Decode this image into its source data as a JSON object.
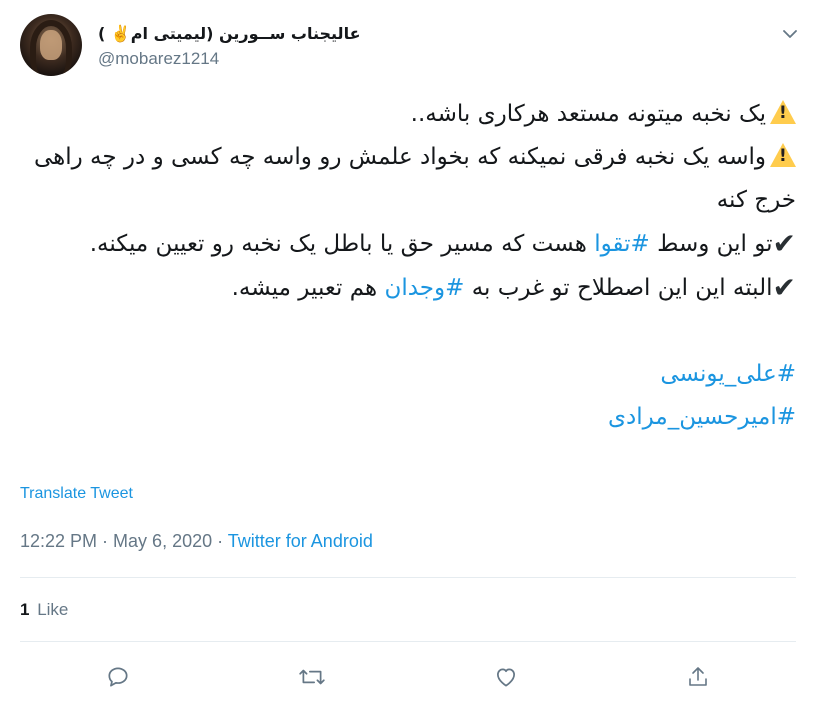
{
  "tweet": {
    "display_name": "عالیجناب ســورین (لیمیتی ام✌️ )",
    "handle": "@mobarez1214",
    "lines": [
      {
        "icon": "warning",
        "parts": [
          {
            "text": "یک نخبه میتونه مستعد هرکاری باشه..",
            "tag": false
          }
        ]
      },
      {
        "icon": "warning",
        "parts": [
          {
            "text": "واسه یک نخبه فرقی نمیکنه که بخواد علمش رو واسه چه کسی و در چه راهی خرج کنه",
            "tag": false
          }
        ]
      },
      {
        "icon": "check",
        "parts": [
          {
            "text": "تو این وسط ",
            "tag": false
          },
          {
            "text": "#تقوا",
            "tag": true
          },
          {
            "text": " هست که مسیر حق یا باطل یک نخبه رو تعیین میکنه.",
            "tag": false
          }
        ]
      },
      {
        "icon": "check",
        "parts": [
          {
            "text": "البته این این اصطلاح تو غرب به ",
            "tag": false
          },
          {
            "text": "#وجدان",
            "tag": true
          },
          {
            "text": " هم تعبیر میشه.",
            "tag": false
          }
        ]
      }
    ],
    "hashtags": [
      "#علی_یونسی",
      "#امیرحسین_مرادی"
    ],
    "translate_label": "Translate Tweet",
    "time": "12:22 PM",
    "date": "May 6, 2020",
    "separator": " · ",
    "source": "Twitter for Android",
    "like_count": "1",
    "like_label": "Like"
  },
  "icons": {
    "more": "chevron-down-icon",
    "reply": "reply-icon",
    "retweet": "retweet-icon",
    "like": "heart-icon",
    "share": "share-icon",
    "warning": "warning-icon",
    "check": "check-icon"
  },
  "colors": {
    "accent": "#1b95e0",
    "muted": "#657786",
    "text": "#14171a",
    "warning": "#ffcc4d"
  }
}
